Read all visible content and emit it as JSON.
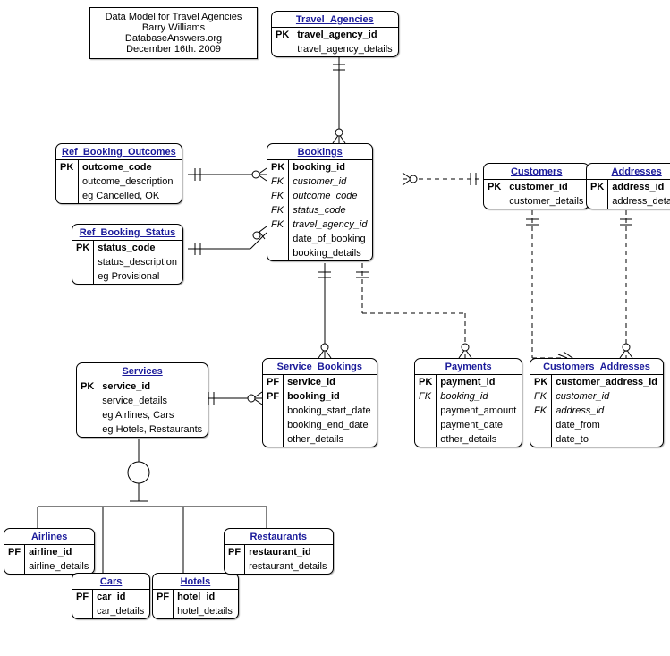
{
  "note": {
    "line1": "Data Model for Travel Agencies",
    "line2": "Barry Williams",
    "line3": "DatabaseAnswers.org",
    "line4": "December 16th. 2009"
  },
  "entities": {
    "travel_agencies": {
      "title": "Travel_Agencies",
      "rows": [
        {
          "key": "PK",
          "attr": "travel_agency_id",
          "pk": true
        },
        {
          "key": "",
          "attr": "travel_agency_details"
        }
      ]
    },
    "bookings": {
      "title": "Bookings",
      "rows": [
        {
          "key": "PK",
          "attr": "booking_id",
          "pk": true
        },
        {
          "key": "FK",
          "attr": "customer_id",
          "fk": true
        },
        {
          "key": "FK",
          "attr": "outcome_code",
          "fk": true
        },
        {
          "key": "FK",
          "attr": "status_code",
          "fk": true
        },
        {
          "key": "FK",
          "attr": "travel_agency_id",
          "fk": true
        },
        {
          "key": "",
          "attr": "date_of_booking"
        },
        {
          "key": "",
          "attr": "booking_details"
        }
      ]
    },
    "customers": {
      "title": "Customers",
      "rows": [
        {
          "key": "PK",
          "attr": "customer_id",
          "pk": true
        },
        {
          "key": "",
          "attr": "customer_details"
        }
      ]
    },
    "addresses": {
      "title": "Addresses",
      "rows": [
        {
          "key": "PK",
          "attr": "address_id",
          "pk": true
        },
        {
          "key": "",
          "attr": "address_details"
        }
      ]
    },
    "ref_booking_outcomes": {
      "title": "Ref_Booking_Outcomes",
      "rows": [
        {
          "key": "PK",
          "attr": "outcome_code",
          "pk": true
        },
        {
          "key": "",
          "attr": "outcome_description"
        },
        {
          "key": "",
          "attr": "eg Cancelled, OK"
        }
      ]
    },
    "ref_booking_status": {
      "title": "Ref_Booking_Status",
      "rows": [
        {
          "key": "PK",
          "attr": "status_code",
          "pk": true
        },
        {
          "key": "",
          "attr": "status_description"
        },
        {
          "key": "",
          "attr": "eg Provisional"
        }
      ]
    },
    "services": {
      "title": "Services",
      "rows": [
        {
          "key": "PK",
          "attr": "service_id",
          "pk": true
        },
        {
          "key": "",
          "attr": "service_details"
        },
        {
          "key": "",
          "attr": "eg Airlines, Cars"
        },
        {
          "key": "",
          "attr": "eg Hotels, Restaurants"
        }
      ]
    },
    "service_bookings": {
      "title": "Service_Bookings",
      "rows": [
        {
          "key": "PF",
          "attr": "service_id",
          "pk": true
        },
        {
          "key": "PF",
          "attr": "booking_id",
          "pk": true
        },
        {
          "key": "",
          "attr": "booking_start_date"
        },
        {
          "key": "",
          "attr": "booking_end_date"
        },
        {
          "key": "",
          "attr": "other_details"
        }
      ]
    },
    "payments": {
      "title": "Payments",
      "rows": [
        {
          "key": "PK",
          "attr": "payment_id",
          "pk": true
        },
        {
          "key": "FK",
          "attr": "booking_id",
          "fk": true
        },
        {
          "key": "",
          "attr": "payment_amount"
        },
        {
          "key": "",
          "attr": "payment_date"
        },
        {
          "key": "",
          "attr": "other_details"
        }
      ]
    },
    "customers_addresses": {
      "title": "Customers_Addresses",
      "rows": [
        {
          "key": "PK",
          "attr": "customer_address_id",
          "pk": true
        },
        {
          "key": "FK",
          "attr": "customer_id",
          "fk": true
        },
        {
          "key": "FK",
          "attr": "address_id",
          "fk": true
        },
        {
          "key": "",
          "attr": "date_from"
        },
        {
          "key": "",
          "attr": "date_to"
        }
      ]
    },
    "airlines": {
      "title": "Airlines",
      "rows": [
        {
          "key": "PF",
          "attr": "airline_id",
          "pk": true
        },
        {
          "key": "",
          "attr": "airline_details"
        }
      ]
    },
    "cars": {
      "title": "Cars",
      "rows": [
        {
          "key": "PF",
          "attr": "car_id",
          "pk": true
        },
        {
          "key": "",
          "attr": "car_details"
        }
      ]
    },
    "hotels": {
      "title": "Hotels",
      "rows": [
        {
          "key": "PF",
          "attr": "hotel_id",
          "pk": true
        },
        {
          "key": "",
          "attr": "hotel_details"
        }
      ]
    },
    "restaurants": {
      "title": "Restaurants",
      "rows": [
        {
          "key": "PF",
          "attr": "restaurant_id",
          "pk": true
        },
        {
          "key": "",
          "attr": "restaurant_details"
        }
      ]
    }
  }
}
